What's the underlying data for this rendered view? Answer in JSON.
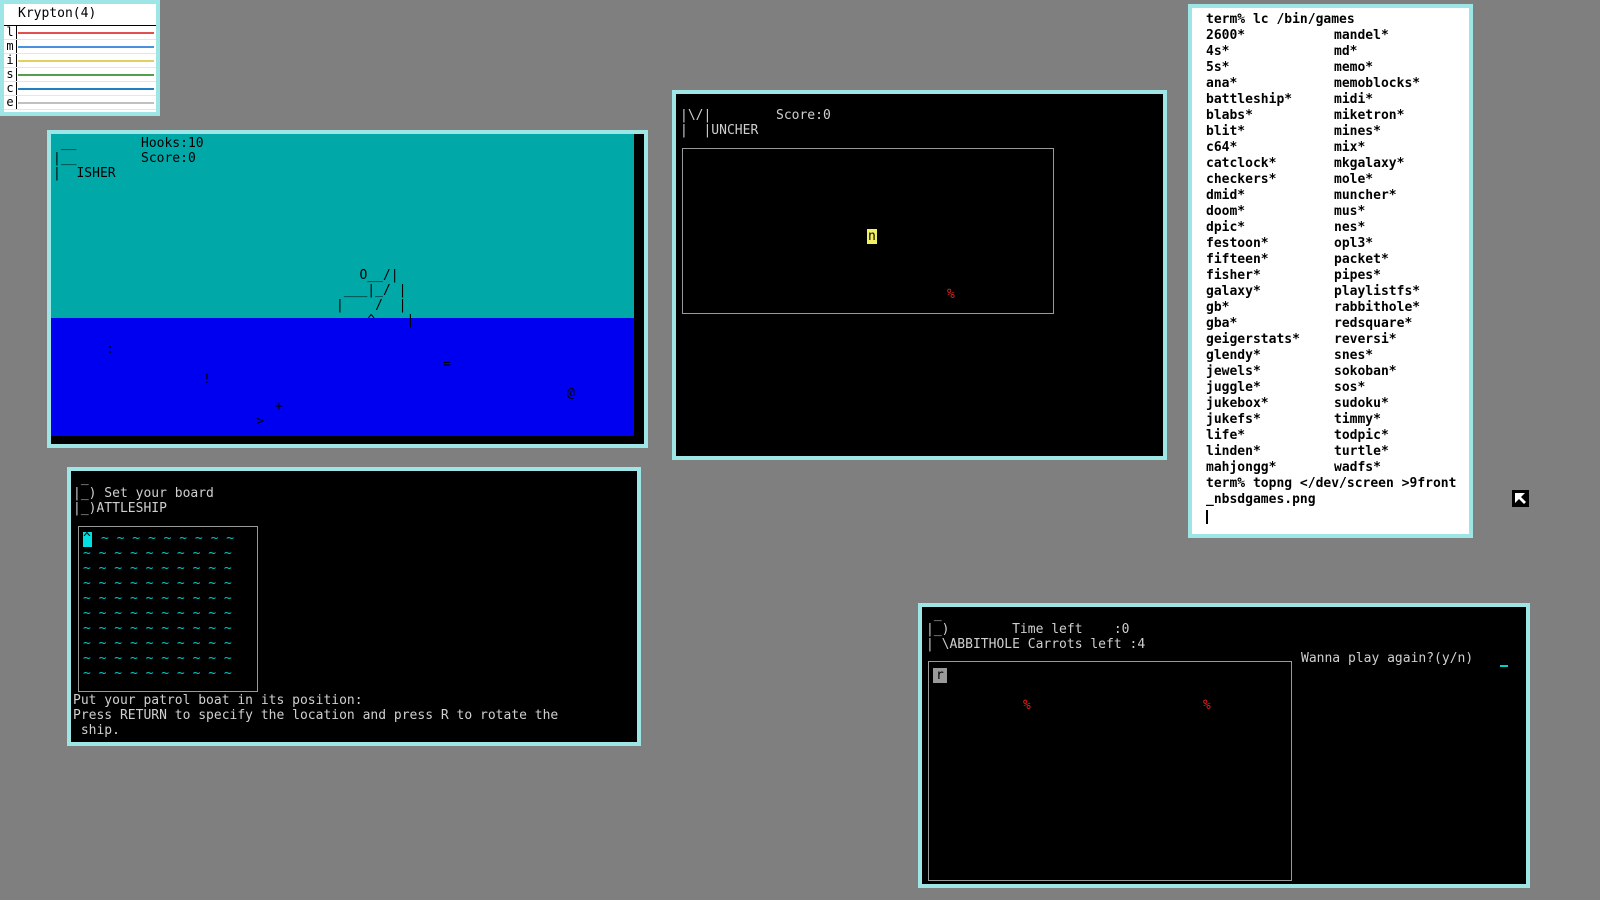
{
  "stats": {
    "title": "Krypton(4)",
    "rows": [
      {
        "label": "l",
        "color": "#e05050"
      },
      {
        "label": "m",
        "color": "#4a90e0"
      },
      {
        "label": "i",
        "color": "#e0d060"
      },
      {
        "label": "s",
        "color": "#50a050"
      },
      {
        "label": "c",
        "color": "#2080c0"
      },
      {
        "label": "e",
        "color": "#c0c0c0"
      }
    ]
  },
  "fisher": {
    "logo_l1": " __",
    "logo_l2": "|__",
    "logo_l3": "|  ISHER",
    "hooks": "Hooks:10",
    "score": "Score:0",
    "boat_l1": "   O__/|",
    "boat_l2": " ___|_/ |",
    "boat_l3": "|    /  |",
    "boat_l4": "    ^    |",
    "fish": [
      ":",
      "=",
      "!",
      "@",
      "+",
      ">"
    ]
  },
  "muncher": {
    "logo_l1": "|\\/|",
    "logo_l2": "|  |UNCHER",
    "score": "Score:0",
    "player": "n",
    "item": "%"
  },
  "terminal": {
    "cmd1": "term% lc /bin/games",
    "left_col": [
      "2600*",
      "4s*",
      "5s*",
      "ana*",
      "battleship*",
      "blabs*",
      "blit*",
      "c64*",
      "catclock*",
      "checkers*",
      "dmid*",
      "doom*",
      "dpic*",
      "festoon*",
      "fifteen*",
      "fisher*",
      "galaxy*",
      "gb*",
      "gba*",
      "geigerstats*",
      "glendy*",
      "jewels*",
      "juggle*",
      "jukebox*",
      "jukefs*",
      "life*",
      "linden*",
      "mahjongg*"
    ],
    "right_col": [
      "mandel*",
      "md*",
      "memo*",
      "memoblocks*",
      "midi*",
      "miketron*",
      "mines*",
      "mix*",
      "mkgalaxy*",
      "mole*",
      "muncher*",
      "mus*",
      "nes*",
      "opl3*",
      "packet*",
      "pipes*",
      "playlistfs*",
      "rabbithole*",
      "redsquare*",
      "reversi*",
      "snes*",
      "sokoban*",
      "sos*",
      "sudoku*",
      "timmy*",
      "todpic*",
      "turtle*",
      "wadfs*"
    ],
    "cmd2": "term% topng </dev/screen >9front",
    "cmd2_cont": "_nbsdgames.png"
  },
  "battleship": {
    "logo_l1": " _",
    "logo_l2": "|_) Set your board",
    "logo_l3": "|_)ATTLESHIP",
    "wave_row": "~ ~ ~ ~ ~ ~ ~ ~ ~ ~",
    "cursor": "^",
    "instr1": "Put your patrol boat in its position:",
    "instr2": "Press RETURN to specify the location and press R to rotate the",
    "instr3": " ship."
  },
  "rabbithole": {
    "logo_l1": " _",
    "logo_l2": "|_)        Time left    :0",
    "logo_l3": "| \\ABBITHOLE Carrots left :4",
    "prompt": "Wanna play again?(y/n)",
    "player": "r",
    "carrot": "%"
  }
}
